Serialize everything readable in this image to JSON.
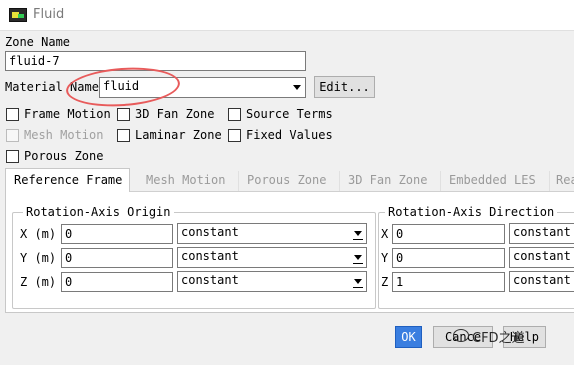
{
  "window": {
    "title": "Fluid"
  },
  "zone": {
    "label": "Zone Name",
    "value": "fluid-7"
  },
  "material": {
    "label": "Material Name",
    "value": "fluid",
    "edit_button": "Edit..."
  },
  "options": [
    {
      "label": "Frame Motion",
      "checked": false,
      "enabled": true
    },
    {
      "label": "3D Fan Zone",
      "checked": false,
      "enabled": true
    },
    {
      "label": "Source Terms",
      "checked": false,
      "enabled": true
    },
    {
      "label": "Mesh Motion",
      "checked": false,
      "enabled": false
    },
    {
      "label": "Laminar Zone",
      "checked": false,
      "enabled": true
    },
    {
      "label": "Fixed Values",
      "checked": false,
      "enabled": true
    },
    {
      "label": "Porous Zone",
      "checked": false,
      "enabled": true
    }
  ],
  "tabs": [
    "Reference Frame",
    "Mesh Motion",
    "Porous Zone",
    "3D Fan Zone",
    "Embedded LES",
    "Rea"
  ],
  "origin": {
    "title": "Rotation-Axis Origin",
    "rows": [
      {
        "label": "X (m)",
        "value": "0",
        "method": "constant"
      },
      {
        "label": "Y (m)",
        "value": "0",
        "method": "constant"
      },
      {
        "label": "Z (m)",
        "value": "0",
        "method": "constant"
      }
    ]
  },
  "direction": {
    "title": "Rotation-Axis Direction",
    "rows": [
      {
        "label": "X",
        "value": "0",
        "method": "constant"
      },
      {
        "label": "Y",
        "value": "0",
        "method": "constant"
      },
      {
        "label": "Z",
        "value": "1",
        "method": "constant"
      }
    ]
  },
  "footer": {
    "ok": "OK",
    "cancel": "Cance",
    "help": "Help"
  },
  "watermark": "CFD之道",
  "colors": {
    "highlight": "#e85b5b",
    "ok_button": "#3a7ee0"
  }
}
